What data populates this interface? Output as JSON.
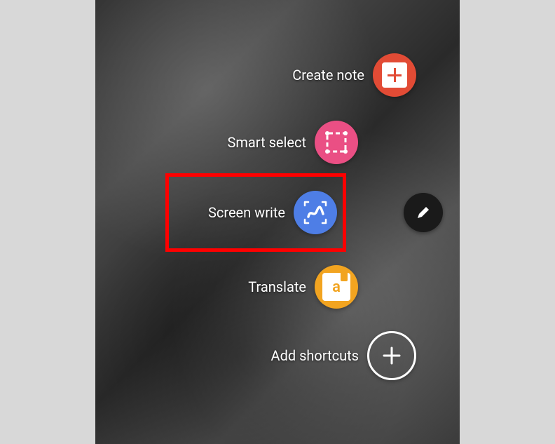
{
  "menu": {
    "items": [
      {
        "label": "Create note",
        "icon": "note-plus-icon",
        "color": "#e24b35"
      },
      {
        "label": "Smart select",
        "icon": "crop-icon",
        "color": "#ea4f84"
      },
      {
        "label": "Screen write",
        "icon": "scribble-icon",
        "color": "#4e7ee6"
      },
      {
        "label": "Translate",
        "icon": "translate-icon",
        "color": "#f2a420"
      },
      {
        "label": "Add shortcuts",
        "icon": "plus-icon",
        "color": "transparent"
      }
    ]
  },
  "highlight": {
    "target_index": 2
  },
  "fab": {
    "icon": "pencil-icon"
  }
}
